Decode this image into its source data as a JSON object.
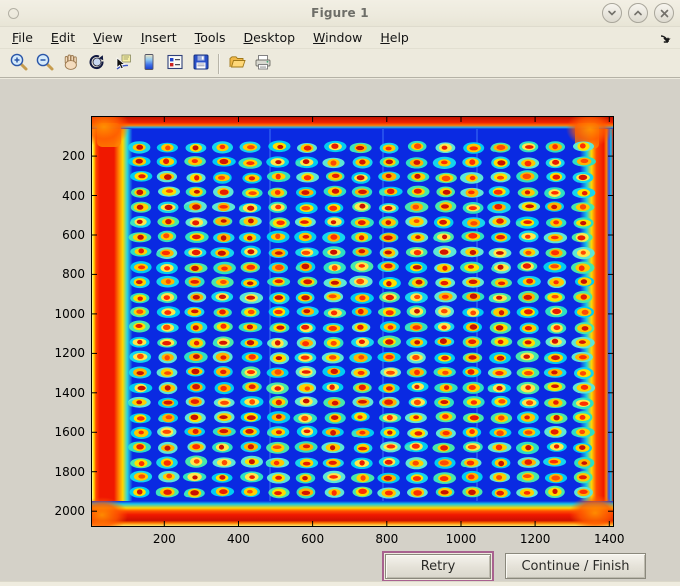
{
  "window": {
    "title": "Figure 1",
    "controls": [
      {
        "name": "shade-window",
        "glyph": "chevron-down"
      },
      {
        "name": "unshade-window",
        "glyph": "chevron-up"
      },
      {
        "name": "close-window",
        "glyph": "x"
      }
    ]
  },
  "menubar": {
    "items": [
      {
        "label": "File"
      },
      {
        "label": "Edit"
      },
      {
        "label": "View"
      },
      {
        "label": "Insert"
      },
      {
        "label": "Tools"
      },
      {
        "label": "Desktop"
      },
      {
        "label": "Window"
      },
      {
        "label": "Help"
      }
    ],
    "dock_icon": "dock-figure"
  },
  "toolbar": {
    "icons": [
      "zoom-in",
      "zoom-out",
      "pan",
      "rotate-3d",
      "data-cursor",
      "insert-colorbar",
      "insert-legend",
      "save-figure",
      "open-file",
      "print-figure"
    ]
  },
  "chart_data": {
    "type": "heatmap",
    "title": "",
    "xlabel": "",
    "ylabel": "",
    "x_ticks": [
      200,
      400,
      600,
      800,
      1000,
      1200,
      1400
    ],
    "y_ticks": [
      200,
      400,
      600,
      800,
      1000,
      1200,
      1400,
      1600,
      1800,
      2000
    ],
    "x_range": [
      5,
      1410
    ],
    "y_range": [
      2,
      2075
    ],
    "grid": false,
    "colormap": "jet",
    "description": "Pseudocolor (jet colormap) scan of a spotted microarray slide: a regular grid of assay spots with red-hot centers, yellow rings and cyan halos on a deep blue background; the slide edges saturate to red/orange bands with bright orange corners.",
    "spot_grid": {
      "rows": 24,
      "cols": 17,
      "x_first": 135,
      "x_last": 1330,
      "y_first": 155,
      "y_last": 1905
    },
    "palette": {
      "background": "#0a2ae2",
      "halo": [
        "#2ce0c4",
        "#14d6ee",
        "#46e8ac",
        "#00cdf2",
        "#5ce8d6"
      ],
      "ring": [
        "#ffdf00",
        "#ffc800",
        "#ffe84a",
        "#ffb400",
        "#ffd000"
      ],
      "center": [
        "#e81c00",
        "#ff2e00",
        "#d41400",
        "#ff4a00",
        "#c81000"
      ],
      "edge_red": "#f01800",
      "corner_orange": "#ff8800"
    }
  },
  "buttons": {
    "retry_label": "Retry",
    "continue_label": "Continue / Finish",
    "retry_focus_ring_color": "#a8618f"
  },
  "colors": {
    "chrome_background": "#EDEADD",
    "figure_background": "#D4D1C8",
    "title_text": "#6E6E68"
  }
}
